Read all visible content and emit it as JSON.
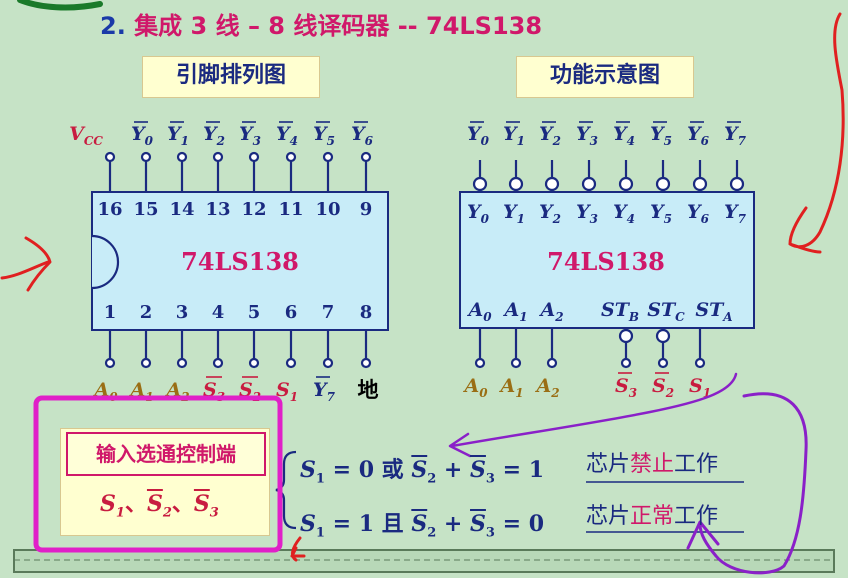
{
  "title": {
    "number": "2.",
    "text": "集成 3 线 – 8 线译码器 -- 74LS138"
  },
  "labels": {
    "pinout": "引脚排列图",
    "function": "功能示意图"
  },
  "chip": {
    "name": "74LS138"
  },
  "pinout": {
    "top_signals": [
      "V",
      "CC",
      "Y",
      "0",
      "Y",
      "1",
      "Y",
      "2",
      "Y",
      "3",
      "Y",
      "4",
      "Y",
      "5",
      "Y",
      "6"
    ],
    "top_numbers": [
      "16",
      "15",
      "14",
      "13",
      "12",
      "11",
      "10",
      "9"
    ],
    "bottom_numbers": [
      "1",
      "2",
      "3",
      "4",
      "5",
      "6",
      "7",
      "8"
    ],
    "bottom_signals": [
      "A",
      "0",
      "A",
      "1",
      "A",
      "2",
      "S",
      "3",
      "S",
      "2",
      "S",
      "1",
      "Y",
      "7",
      "地"
    ]
  },
  "function": {
    "top_inside": [
      "Y",
      "0",
      "Y",
      "1",
      "Y",
      "2",
      "Y",
      "3",
      "Y",
      "4",
      "Y",
      "5",
      "Y",
      "6",
      "Y",
      "7"
    ],
    "bottom_inside": [
      "A",
      "0",
      "A",
      "1",
      "A",
      "2",
      "ST",
      "B",
      "ST",
      "C",
      "ST",
      "A"
    ],
    "bottom_signals": [
      "A",
      "0",
      "A",
      "1",
      "A",
      "2",
      "S",
      "3",
      "S",
      "2",
      "S",
      "1"
    ]
  },
  "control": {
    "title": "输入选通控制端",
    "signals": [
      "S",
      "1",
      "、",
      "S",
      "2",
      "、",
      "S",
      "3"
    ]
  },
  "equations": {
    "line1": {
      "a": "S",
      "a_sub": "1",
      "mid": " = 0 或 ",
      "b": "S",
      "b_sub": "2",
      "plus": " + ",
      "c": "S",
      "c_sub": "3",
      "end": " = 1"
    },
    "line2": {
      "a": "S",
      "a_sub": "1",
      "mid": " = 1 且 ",
      "b": "S",
      "b_sub": "2",
      "plus": " + ",
      "c": "S",
      "c_sub": "3",
      "end": " = 0"
    }
  },
  "results": {
    "r1_pre": "芯片",
    "r1_mid": "禁止",
    "r1_post": "工作",
    "r2_pre": "芯片",
    "r2_mid": "正常",
    "r2_post": "工作"
  },
  "colors": {
    "background": "#c6e3c6",
    "accent": "#d0186a",
    "ink": "#1a2a80",
    "annotation_red": "#e02020",
    "annotation_purple": "#8a20c8",
    "highlight": "#e020c8"
  }
}
